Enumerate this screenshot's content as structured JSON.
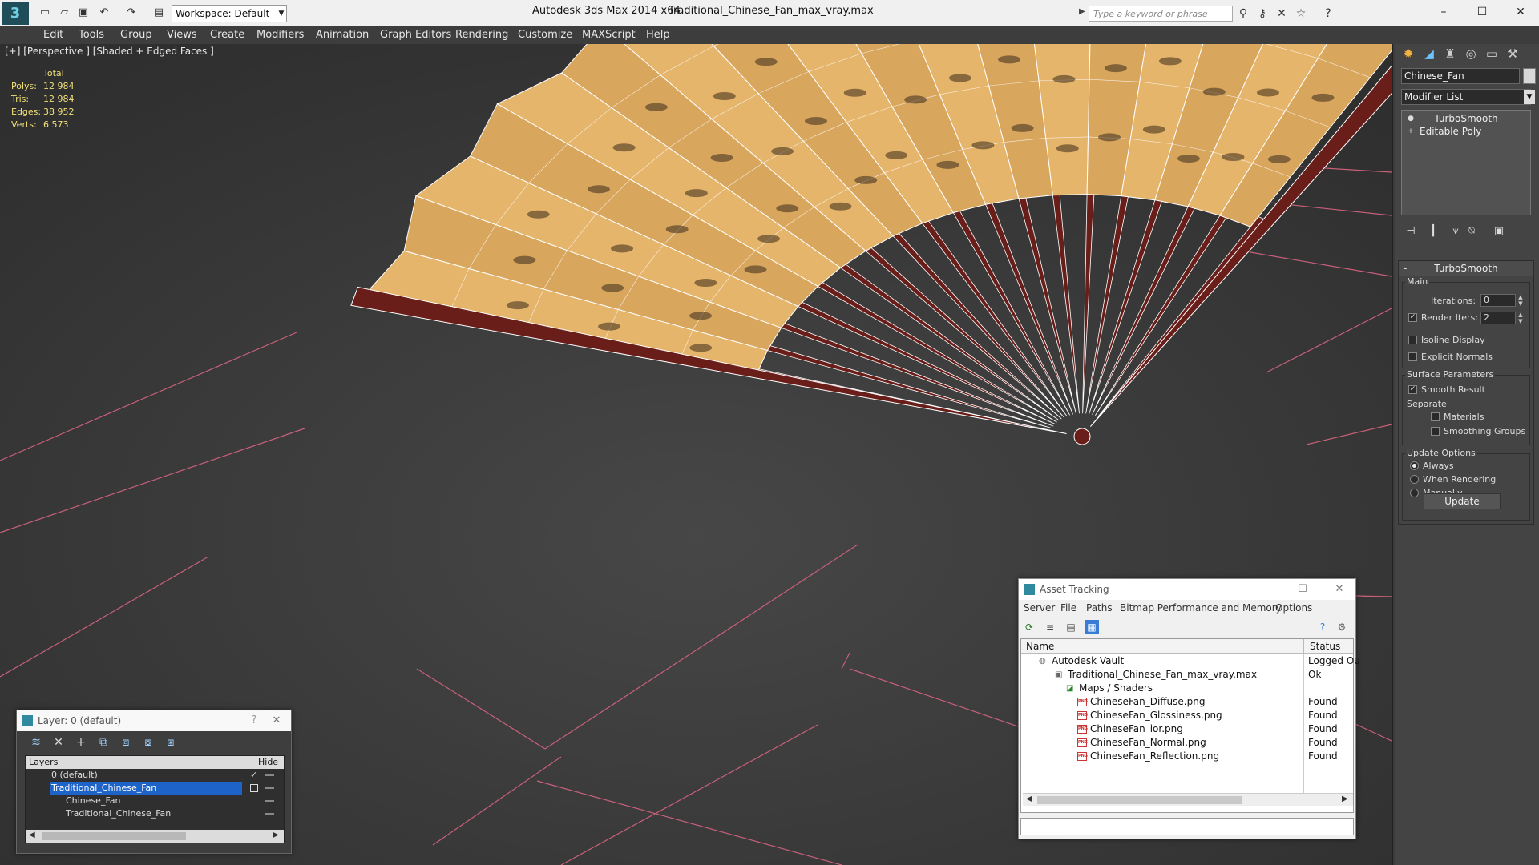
{
  "titlebar": {
    "workspace": "Workspace: Default",
    "app_title": "Autodesk 3ds Max  2014 x64",
    "file_title": "Traditional_Chinese_Fan_max_vray.max",
    "search_placeholder": "Type a keyword or phrase"
  },
  "menu": [
    "Edit",
    "Tools",
    "Group",
    "Views",
    "Create",
    "Modifiers",
    "Animation",
    "Graph Editors",
    "Rendering",
    "Customize",
    "MAXScript",
    "Help"
  ],
  "viewport": {
    "label": "[+] [Perspective ] [Shaded + Edged Faces ]",
    "stats": {
      "header": "Total",
      "polys_label": "Polys:",
      "polys": "12 984",
      "tris_label": "Tris:",
      "tris": "12 984",
      "edges_label": "Edges:",
      "edges": "38 952",
      "verts_label": "Verts:",
      "verts": "6 573"
    }
  },
  "command_panel": {
    "object_name": "Chinese_Fan",
    "modifier_list": "Modifier List",
    "stack": [
      "TurboSmooth",
      "Editable Poly"
    ],
    "rollout_title": "TurboSmooth",
    "main_group": "Main",
    "iterations_label": "Iterations:",
    "iterations_value": "0",
    "render_iters_label": "Render Iters:",
    "render_iters_value": "2",
    "render_iters_checked": true,
    "isoline_display": "Isoline Display",
    "explicit_normals": "Explicit Normals",
    "surface_group": "Surface Parameters",
    "smooth_result": "Smooth Result",
    "smooth_result_checked": true,
    "separate_label": "Separate",
    "materials": "Materials",
    "smoothing_groups": "Smoothing Groups",
    "update_group": "Update Options",
    "opt_always": "Always",
    "opt_when_rendering": "When Rendering",
    "opt_manually": "Manually",
    "update_button": "Update"
  },
  "layer_window": {
    "title": "Layer: 0 (default)",
    "col_layers": "Layers",
    "col_hide": "Hide",
    "rows": [
      {
        "name": "0 (default)",
        "indent": 1
      },
      {
        "name": "Traditional_Chinese_Fan",
        "indent": 1,
        "selected": true
      },
      {
        "name": "Chinese_Fan",
        "indent": 2
      },
      {
        "name": "Traditional_Chinese_Fan",
        "indent": 2
      }
    ]
  },
  "asset_window": {
    "title": "Asset Tracking",
    "menu": [
      "Server",
      "File",
      "Paths",
      "Bitmap Performance and Memory",
      "Options"
    ],
    "col_name": "Name",
    "col_status": "Status",
    "rows": [
      {
        "name": "Autodesk Vault",
        "status": "Logged Ou",
        "level": 0
      },
      {
        "name": "Traditional_Chinese_Fan_max_vray.max",
        "status": "Ok",
        "level": 1
      },
      {
        "name": "Maps / Shaders",
        "status": "",
        "level": 2
      },
      {
        "name": "ChineseFan_Diffuse.png",
        "status": "Found",
        "level": 3
      },
      {
        "name": "ChineseFan_Glossiness.png",
        "status": "Found",
        "level": 3
      },
      {
        "name": "ChineseFan_ior.png",
        "status": "Found",
        "level": 3
      },
      {
        "name": "ChineseFan_Normal.png",
        "status": "Found",
        "level": 3
      },
      {
        "name": "ChineseFan_Reflection.png",
        "status": "Found",
        "level": 3
      }
    ],
    "png_badge": "PNG"
  },
  "colors": {
    "viewport_bg": "#3b3b3b",
    "grid_pink": "#c8607a",
    "paper": "#e6b56c",
    "rib": "#6a1e1a",
    "stats_yellow": "#f1e07a",
    "selection_blue": "#1e63c8"
  }
}
